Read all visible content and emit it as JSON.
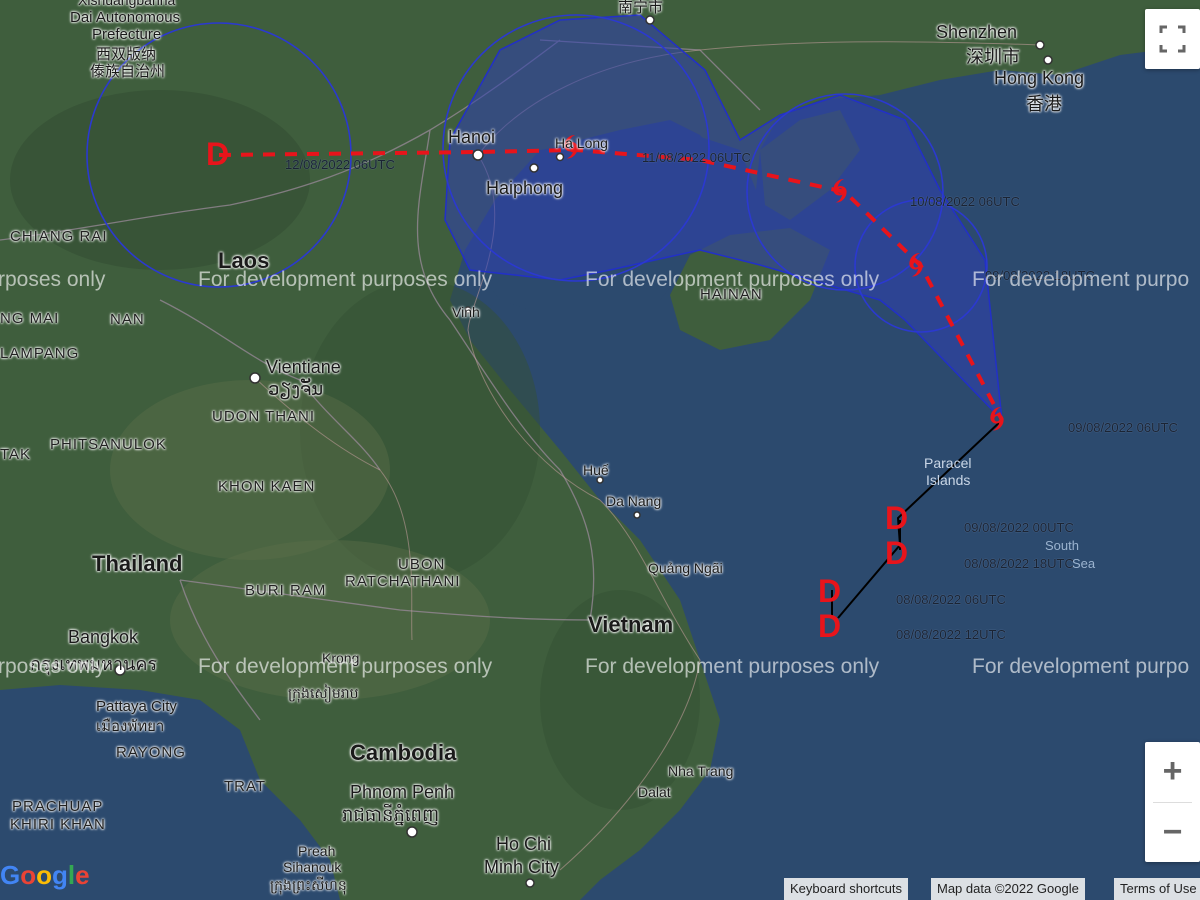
{
  "places": {
    "xishuangbanna": "Xishuangbanna",
    "dai_autonomous": "Dai Autonomous",
    "prefecture": "Prefecture",
    "xishuangbanna_cn1": "西双版纳",
    "xishuangbanna_cn2": "傣族自治州",
    "nanning": "南宁市",
    "shenzhen": "Shenzhen",
    "shenzhen_cn": "深圳市",
    "hong_kong": "Hong Kong",
    "hong_kong_cn": "香港",
    "hanoi": "Hanoi",
    "haiphong": "Haiphong",
    "ha_long": "Ha Long",
    "chiang_rai": "CHIANG RAI",
    "laos": "Laos",
    "hainan": "HAINAN",
    "chiang_mai": "NG MAI",
    "nan": "NAN",
    "lampang": "LAMPANG",
    "vinh": "Vinh",
    "vientiane": "Vientiane",
    "vientiane_lo": "ວຽງຈັນ",
    "udon_thani": "UDON THANI",
    "phitsanulok": "PHITSANULOK",
    "tak": "TAK",
    "khon_kaen": "KHON KAEN",
    "hue": "Huế",
    "da_nang": "Da Nang",
    "paracel": "Paracel",
    "islands": "Islands",
    "south": "South",
    "sea": "Sea",
    "thailand": "Thailand",
    "ubon": "UBON",
    "ratchathani": "RATCHATHANI",
    "buri_ram": "BURI RAM",
    "quang_ngai": "Quảng Ngãi",
    "vietnam": "Vietnam",
    "bangkok": "Bangkok",
    "bangkok_th": "กรุงเทพมหานคร",
    "kon_tum": "Kon Tum",
    "krong": "Krong",
    "siem_reap_km": "ក្រុងសៀមរាប",
    "pattaya": "Pattaya City",
    "pattaya_th": "เมืองพัทยา",
    "rayong": "RAYONG",
    "cambodia": "Cambodia",
    "nha_trang": "Nha Trang",
    "trat": "TRAT",
    "dalat": "Dalat",
    "phnom_penh": "Phnom Penh",
    "phnom_penh_km": "រាជធានីភ្នំពេញ",
    "prachuap": "PRACHUAP",
    "khiri_khan": "KHIRI KHAN",
    "preah": "Preah",
    "sihanouk": "Sihanouk",
    "sihanouk_km": "ក្រុងព្រះសីហនុ",
    "ho_chi": "Ho Chi",
    "minh_city": "Minh City",
    "ubon_partial": "ubon"
  },
  "storm_track": {
    "observed": [
      {
        "time": "08/08/2022 12UTC",
        "symbol": "D"
      },
      {
        "time": "08/08/2022 06UTC",
        "symbol": "D"
      },
      {
        "time": "08/08/2022 18UTC",
        "symbol": "D"
      },
      {
        "time": "09/08/2022 00UTC",
        "symbol": "D"
      },
      {
        "time": "09/08/2022 06UTC",
        "symbol": "cyclone"
      }
    ],
    "forecast": [
      {
        "time": "09/08/2022 18UTC",
        "symbol": "cyclone"
      },
      {
        "time": "10/08/2022 06UTC",
        "symbol": "cyclone"
      },
      {
        "time": "11/08/2022 06UTC",
        "symbol": "cyclone"
      },
      {
        "time": "12/08/2022 06UTC",
        "symbol": "D"
      }
    ],
    "colors": {
      "track_marker": "#e8141b",
      "cone_fill": "#2f3fb3",
      "cone_stroke": "#2230c8",
      "observed_line": "#000000"
    }
  },
  "watermark": "For development purposes only",
  "watermark_partial_left": "rposes only",
  "watermark_partial_right": "For development purpo",
  "controls": {
    "fullscreen_icon": "fullscreen-icon",
    "zoom_in": "+",
    "zoom_out": "−"
  },
  "attribution": {
    "keyboard": "Keyboard shortcuts",
    "map_data": "Map data ©2022 Google",
    "terms": "Terms of Use"
  },
  "logo": "Google"
}
